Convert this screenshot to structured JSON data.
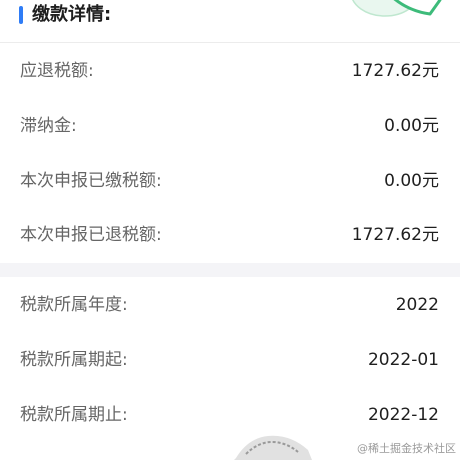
{
  "header": {
    "title": "缴款详情:"
  },
  "refund_section": [
    {
      "label": "应退税额:",
      "value": "1727.62元"
    },
    {
      "label": "滞纳金:",
      "value": "0.00元"
    },
    {
      "label": "本次申报已缴税额:",
      "value": "0.00元"
    },
    {
      "label": "本次申报已退税额:",
      "value": "1727.62元"
    }
  ],
  "period_section": [
    {
      "label": "税款所属年度:",
      "value": "2022"
    },
    {
      "label": "税款所属期起:",
      "value": "2022-01"
    },
    {
      "label": "税款所属期止:",
      "value": "2022-12"
    }
  ],
  "watermark": "@稀土掘金技术社区",
  "colors": {
    "accent": "#2f7cf6",
    "deco_green": "#3dbb7a",
    "divider_bg": "#f4f4f7"
  }
}
